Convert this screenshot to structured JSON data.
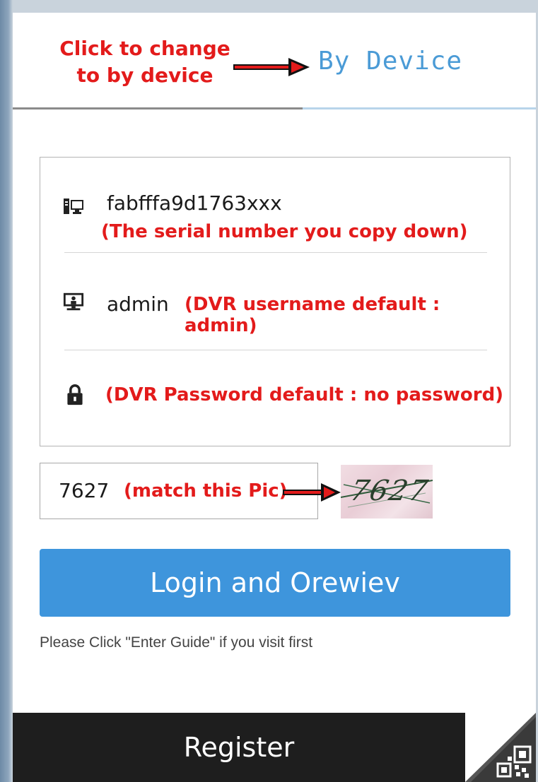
{
  "header": {
    "annotation": "Click to change to by device",
    "tab_label": "By Device"
  },
  "form": {
    "serial": {
      "value": "fabfffa9d1763xxx",
      "annotation": "(The serial number you copy down)"
    },
    "username": {
      "value": "admin",
      "annotation": "(DVR username default : admin)"
    },
    "password": {
      "annotation": "(DVR Password default : no password)"
    }
  },
  "captcha": {
    "value": "7627",
    "annotation": "(match this Pic)",
    "image_text": "7627"
  },
  "login_button": "Login and Orewiev",
  "hint": "Please Click \"Enter Guide\" if you visit first",
  "register_button": "Register",
  "icons": {
    "serial": "device-icon",
    "username": "monitor-user-icon",
    "password": "lock-icon",
    "corner": "qr-code-icon",
    "arrow": "arrow-right-icon"
  },
  "colors": {
    "annotation": "#e31b1b",
    "tab": "#4b9bd6",
    "login": "#3e95dc",
    "register": "#1e1e1e"
  }
}
